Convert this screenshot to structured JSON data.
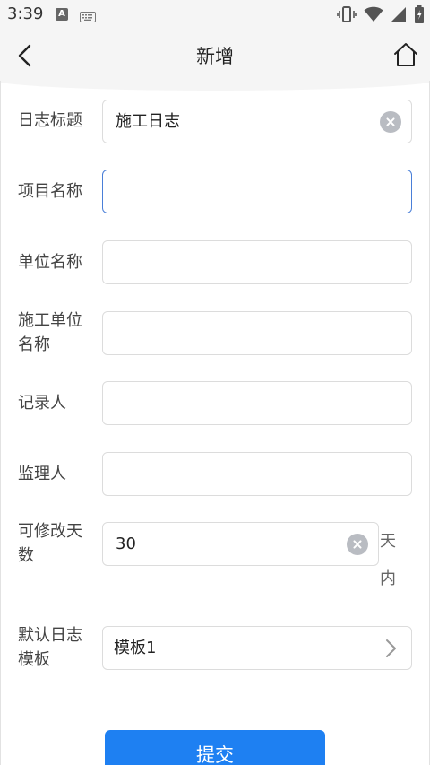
{
  "status": {
    "time": "3:39",
    "a_icon": "A"
  },
  "nav": {
    "title": "新增"
  },
  "form": {
    "log_title": {
      "label": "日志标题",
      "value": "施工日志"
    },
    "project_name": {
      "label": "项目名称",
      "value": ""
    },
    "unit_name": {
      "label": "单位名称",
      "value": ""
    },
    "construction_unit": {
      "label_line1": "施工单位",
      "label_line2": "名称",
      "value": ""
    },
    "recorder": {
      "label": "记录人",
      "value": ""
    },
    "supervisor": {
      "label": "监理人",
      "value": ""
    },
    "editable_days": {
      "label_line1": "可修改天",
      "label_line2": "数",
      "value": "30",
      "suffix_line1": "天",
      "suffix_line2": "内"
    },
    "default_template": {
      "label_line1": "默认日志",
      "label_line2": "模板",
      "value": "模板1"
    }
  },
  "submit_label": "提交",
  "colors": {
    "accent": "#1e80f2",
    "active_border": "#4a7fd8",
    "header_bg": "#f5f5f5"
  }
}
